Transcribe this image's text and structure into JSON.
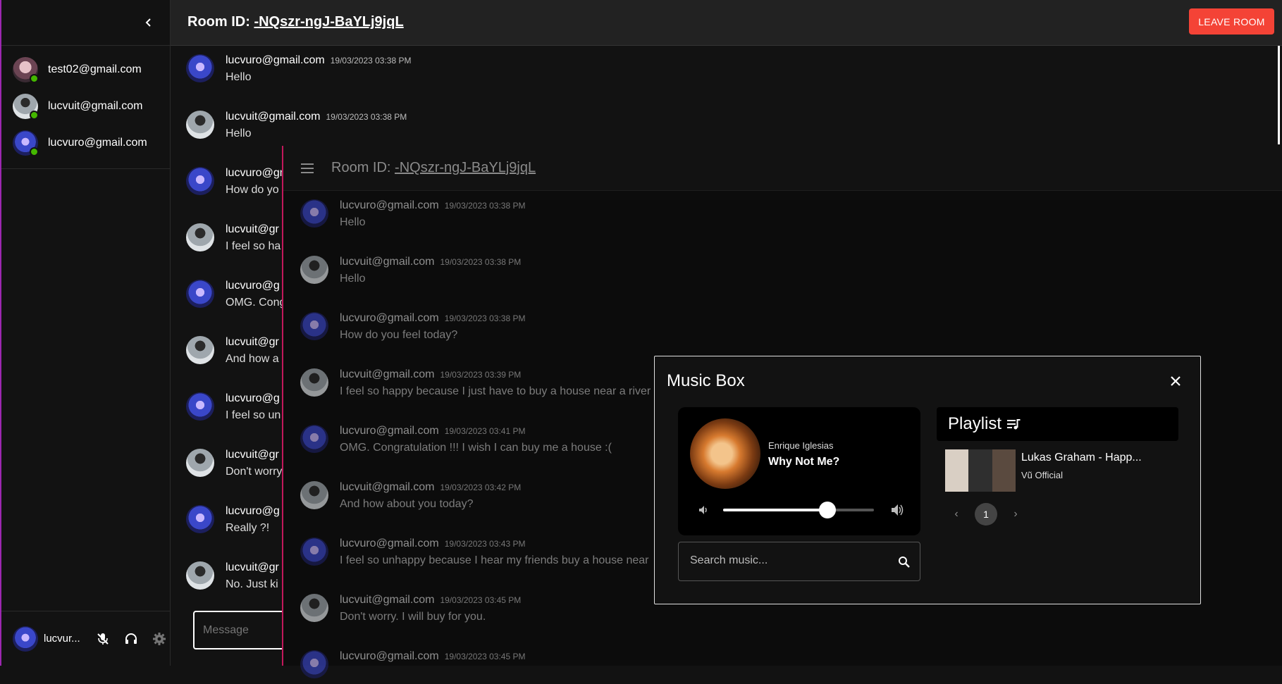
{
  "sidebar": {
    "users": [
      {
        "email": "test02@gmail.com",
        "avatar": "anime-avatar"
      },
      {
        "email": "lucvuit@gmail.com",
        "avatar": "silhouette-avatar"
      },
      {
        "email": "lucvuro@gmail.com",
        "avatar": "blue-avatar"
      }
    ],
    "self_name": "lucvur..."
  },
  "header": {
    "room_label": "Room ID: ",
    "room_id": "-NQszr-ngJ-BaYLj9jqL",
    "leave_label": "LEAVE ROOM"
  },
  "background_chat": {
    "messages": [
      {
        "author": "lucvuro@gmail.com",
        "time": "19/03/2023 03:38 PM",
        "text": "Hello"
      },
      {
        "author": "lucvuit@gmail.com",
        "time": "19/03/2023 03:38 PM",
        "text": "Hello"
      },
      {
        "author": "lucvuro@gm",
        "time": "",
        "text": "How do yo"
      },
      {
        "author": "lucvuit@gr",
        "time": "",
        "text": "I feel so ha"
      },
      {
        "author": "lucvuro@g",
        "time": "",
        "text": "OMG. Cong"
      },
      {
        "author": "lucvuit@gr",
        "time": "",
        "text": "And how a"
      },
      {
        "author": "lucvuro@g",
        "time": "",
        "text": "I feel so un"
      },
      {
        "author": "lucvuit@gr",
        "time": "",
        "text": "Don't worry"
      },
      {
        "author": "lucvuro@g",
        "time": "",
        "text": "Really ?!"
      },
      {
        "author": "lucvuit@gr",
        "time": "",
        "text": "No. Just ki"
      }
    ],
    "input_placeholder": "Message"
  },
  "overlay": {
    "room_label": "Room ID: ",
    "room_id": "-NQszr-ngJ-BaYLj9jqL",
    "messages": [
      {
        "author": "lucvuro@gmail.com",
        "time": "19/03/2023 03:38 PM",
        "text": "Hello"
      },
      {
        "author": "lucvuit@gmail.com",
        "time": "19/03/2023 03:38 PM",
        "text": "Hello"
      },
      {
        "author": "lucvuro@gmail.com",
        "time": "19/03/2023 03:38 PM",
        "text": "How do you feel today?"
      },
      {
        "author": "lucvuit@gmail.com",
        "time": "19/03/2023 03:39 PM",
        "text": "I feel so happy because I just have to buy a house near a river"
      },
      {
        "author": "lucvuro@gmail.com",
        "time": "19/03/2023 03:41 PM",
        "text": "OMG. Congratulation !!! I wish I can buy me a house :("
      },
      {
        "author": "lucvuit@gmail.com",
        "time": "19/03/2023 03:42 PM",
        "text": "And how about you today?"
      },
      {
        "author": "lucvuro@gmail.com",
        "time": "19/03/2023 03:43 PM",
        "text": "I feel so unhappy because I hear my friends buy a house near"
      },
      {
        "author": "lucvuit@gmail.com",
        "time": "19/03/2023 03:45 PM",
        "text": "Don't worry. I will buy for you."
      },
      {
        "author": "lucvuro@gmail.com",
        "time": "19/03/2023 03:45 PM",
        "text": ""
      }
    ]
  },
  "music_box": {
    "title": "Music Box",
    "now_playing": {
      "artist": "Enrique Iglesias",
      "song": "Why Not Me?"
    },
    "volume_fraction": 0.69,
    "search_placeholder": "Search music...",
    "playlist_title": "Playlist",
    "tracks": [
      {
        "title": "Lukas Graham - Happ...",
        "channel": "Vũ Official"
      }
    ],
    "page": "1"
  },
  "colors": {
    "leave_button": "#f44336",
    "online": "#44b700",
    "accent_left": "#9c27b0",
    "overlay_border": "#c2185b"
  }
}
